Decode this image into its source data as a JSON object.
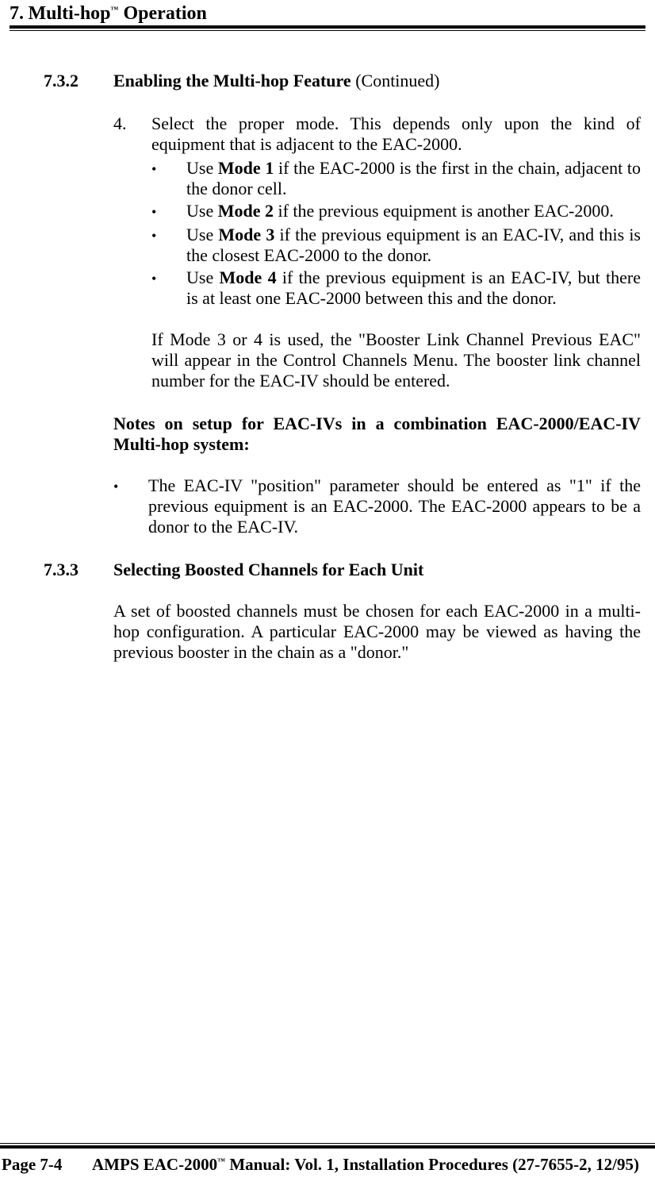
{
  "header": {
    "chapter_num": "7.",
    "chapter_title_pre": "Multi-hop",
    "chapter_title_post": " Operation",
    "tm": "™"
  },
  "section_732": {
    "number": "7.3.2",
    "title": "Enabling the Multi-hop Feature",
    "continued": "  (Continued)"
  },
  "step4": {
    "num": "4.",
    "text": "Select the proper mode.  This depends only upon the kind of equipment that is adjacent to the EAC-2000."
  },
  "bullets": [
    {
      "pre": "Use ",
      "bold": "Mode 1",
      "post": " if the EAC-2000 is the first in the chain, adjacent to the donor cell."
    },
    {
      "pre": "Use ",
      "bold": "Mode 2",
      "post": " if the previous equipment is another EAC-2000."
    },
    {
      "pre": "Use ",
      "bold": "Mode 3",
      "post": " if the previous equipment is an EAC-IV, and this is the closest EAC-2000 to the donor."
    },
    {
      "pre": "Use ",
      "bold": "Mode 4",
      "post": " if the previous equipment is an EAC-IV, but there is at least one EAC-2000 between this and the donor."
    }
  ],
  "mode34_para": "If Mode 3 or 4 is used, the \"Booster Link Channel Previous EAC\" will appear in the Control Channels Menu.  The booster link channel number for the EAC-IV should be entered.",
  "notes_heading": "Notes on setup for EAC-IVs in a combination EAC-2000/EAC-IV Multi-hop system:",
  "notes_bullet": "The EAC-IV \"position\" parameter should be entered as \"1\" if the previous equipment is an EAC-2000.  The EAC-2000 appears to be a donor to the EAC-IV.",
  "section_733": {
    "number": "7.3.3",
    "title": "Selecting Boosted Channels for Each Unit"
  },
  "section_733_body": "A set of boosted channels must be chosen for each EAC-2000 in a multi-hop configuration.  A particular EAC-2000 may be viewed as having the previous booster in the chain as a \"donor.\"",
  "footer": {
    "page": "Page 7-4",
    "manual_pre": "AMPS EAC-2000",
    "tm": "™",
    "manual_post": " Manual:  Vol. 1, Installation Procedures (27-7655-2, 12/95)"
  },
  "bullet_char": "•"
}
